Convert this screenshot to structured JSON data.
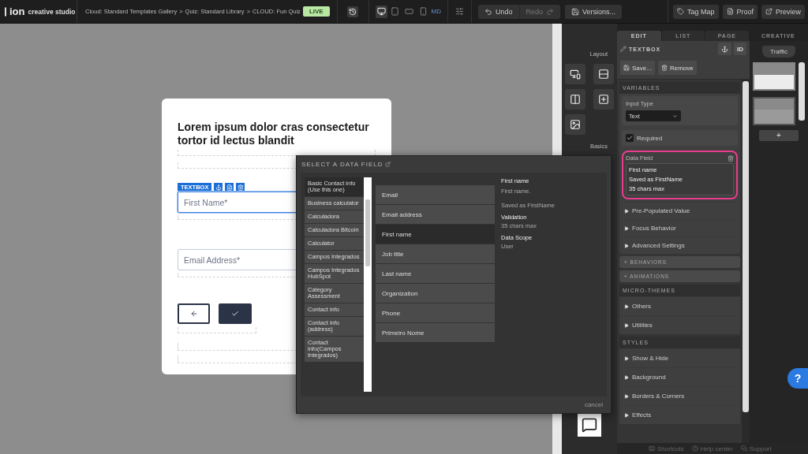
{
  "app": {
    "logo": "ion",
    "product": "creative studio"
  },
  "breadcrumb": {
    "items": [
      "Cloud: Standard Templates Gallery",
      "Quiz: Standard Library",
      "CLOUD: Fun Quiz"
    ],
    "separator": ">"
  },
  "live_badge": "LIVE",
  "devices": [
    {
      "kind": "desktop",
      "selected": true
    },
    {
      "kind": "tablet",
      "selected": false
    },
    {
      "kind": "landscape",
      "selected": false
    },
    {
      "kind": "phone",
      "selected": false
    }
  ],
  "size_label": "MD",
  "history": {
    "undo": "Undo",
    "redo": "Redo",
    "redo_disabled": true
  },
  "versions": "Versions...",
  "actions": [
    {
      "label": "Tag Map",
      "kind": "tag"
    },
    {
      "label": "Proof",
      "kind": "document"
    },
    {
      "label": "Preview",
      "kind": "preview"
    }
  ],
  "card": {
    "title": "Lorem ipsum dolor cras consectetur tortor id lectus blandit",
    "toolbar_label": "TEXTBOX",
    "fields": [
      {
        "placeholder": "First Name*",
        "selected": true
      },
      {
        "placeholder": "Email Address*",
        "selected": false
      }
    ]
  },
  "tool_strip": {
    "layout_heading": "Layout",
    "basics_heading": "Basics",
    "layout_tools": [
      {
        "kind": "device-form"
      },
      {
        "kind": "rows"
      },
      {
        "kind": "columns"
      },
      {
        "kind": "insert"
      },
      {
        "kind": "media"
      }
    ]
  },
  "modal": {
    "title": "SELECT A DATA FIELD",
    "categories": [
      {
        "label": "Basic Contact info (Use this one)",
        "selected": true
      },
      {
        "label": "Business calculator",
        "selected": false
      },
      {
        "label": "Calculadora",
        "selected": false
      },
      {
        "label": "Calculadora Bitcoin",
        "selected": false
      },
      {
        "label": "Calculator",
        "selected": false
      },
      {
        "label": "Campos Integrados",
        "selected": false
      },
      {
        "label": "Campos Integrados HubSpot",
        "selected": false
      },
      {
        "label": "Category Assessment",
        "selected": false
      },
      {
        "label": "Contact info",
        "selected": false
      },
      {
        "label": "Contact info (address)",
        "selected": false
      },
      {
        "label": "Contact info(Campos Integrados)",
        "selected": false
      }
    ],
    "fields": [
      {
        "label": "Email",
        "selected": false
      },
      {
        "label": "Email address",
        "selected": false
      },
      {
        "label": "First name",
        "selected": true
      },
      {
        "label": "Job title",
        "selected": false
      },
      {
        "label": "Last name",
        "selected": false
      },
      {
        "label": "Organization",
        "selected": false
      },
      {
        "label": "Phone",
        "selected": false
      },
      {
        "label": "Primeiro Nome",
        "selected": false
      }
    ],
    "detail": {
      "name": "First name",
      "description": "First name.",
      "saved_as": "Saved as FirstName",
      "validation_label": "Validation",
      "validation": "35 chars max",
      "scope_label": "Data Scope",
      "scope": "User"
    },
    "cancel": "cancel"
  },
  "panel_tabs": [
    {
      "label": "EDIT",
      "selected": true
    },
    {
      "label": "LIST",
      "selected": false
    },
    {
      "label": "PAGE",
      "selected": false
    },
    {
      "label": "CREATIVE",
      "selected": false
    }
  ],
  "panel": {
    "element": "TEXTBOX",
    "id_button": "ID",
    "save": "Save...",
    "remove": "Remove",
    "variables": {
      "heading": "VARIABLES",
      "input_type_label": "Input Type",
      "input_type": "Text",
      "required_label": "Required",
      "required": true,
      "data_field": {
        "label": "Data Field",
        "highlighted": true,
        "lines": [
          "First name",
          "Saved as FirstName",
          "35 chars max"
        ]
      },
      "options": [
        "Pre-Populated Value",
        "Focus Behavior",
        "Advanced Settings"
      ]
    },
    "bars": [
      "+ BEHAVIORS",
      "+ ANIMATIONS"
    ],
    "sections": [
      {
        "heading": "MICRO-THEMES",
        "items": [
          "Others",
          "Utilities"
        ]
      },
      {
        "heading": "STYLES",
        "items": [
          "Show & Hide",
          "Background",
          "Borders & Corners",
          "Effects"
        ]
      }
    ]
  },
  "creative": {
    "tab": "Traffic",
    "thumbnails": [
      {
        "selected": true
      },
      {
        "selected": false
      }
    ],
    "add": "+"
  },
  "status_bar": [
    {
      "label": "Shortcuts",
      "kind": "keyboard"
    },
    {
      "label": "Help center",
      "kind": "help"
    },
    {
      "label": "Support",
      "kind": "chat"
    }
  ],
  "help_button": "?"
}
